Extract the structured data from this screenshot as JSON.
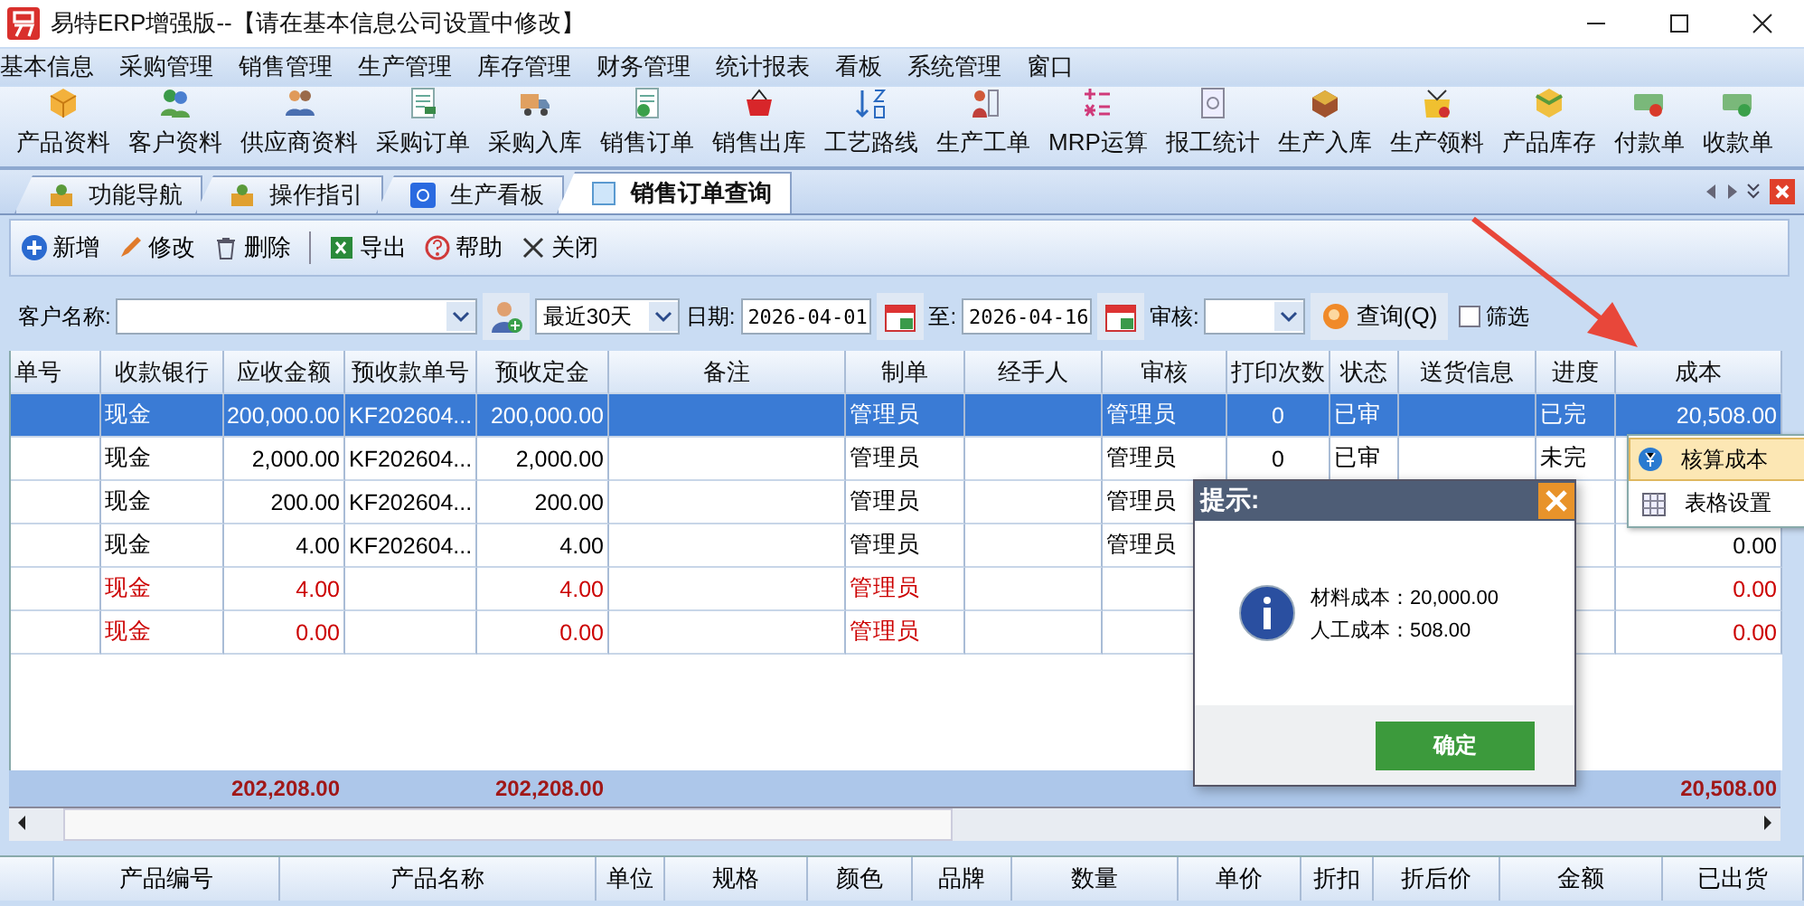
{
  "window": {
    "title": "易特ERP增强版--【请在基本信息公司设置中修改】"
  },
  "menu": [
    "基本信息",
    "采购管理",
    "销售管理",
    "生产管理",
    "库存管理",
    "财务管理",
    "统计报表",
    "看板",
    "系统管理",
    "窗口"
  ],
  "toolbar": [
    "产品资料",
    "客户资料",
    "供应商资料",
    "采购订单",
    "采购入库",
    "销售订单",
    "销售出库",
    "工艺路线",
    "生产工单",
    "MRP运算",
    "报工统计",
    "生产入库",
    "生产领料",
    "产品库存",
    "付款单",
    "收款单"
  ],
  "tabs": [
    {
      "label": "功能导航",
      "selected": false
    },
    {
      "label": "操作指引",
      "selected": false
    },
    {
      "label": "生产看板",
      "selected": false
    },
    {
      "label": "销售订单查询",
      "selected": true
    }
  ],
  "actions": [
    "新增",
    "修改",
    "删除",
    "导出",
    "帮助",
    "关闭"
  ],
  "filter": {
    "customer_label": "客户名称:",
    "period": "最近30天",
    "date_label": "日期:",
    "date_from": "2026-04-01",
    "to_label": "至:",
    "date_to": "2026-04-16",
    "audit_label": "审核:",
    "query_button": "查询(Q)",
    "filter_checkbox": {
      "label": "筛选",
      "checked": false
    }
  },
  "grid": {
    "columns": [
      "单号",
      "收款银行",
      "应收金额",
      "预收款单号",
      "预收定金",
      "备注",
      "制单",
      "经手人",
      "审核",
      "打印次数",
      "状态",
      "送货信息",
      "进度",
      "成本"
    ],
    "rows": [
      {
        "selected": true,
        "flagged": false,
        "bank": "现金",
        "receivable": "200,000.00",
        "prepay_no": "KF202604...",
        "deposit": "200,000.00",
        "creator": "管理员",
        "auditor": "管理员",
        "print_count": "0",
        "status": "已审",
        "progress": "已完",
        "cost": "20,508.00"
      },
      {
        "selected": false,
        "flagged": false,
        "bank": "现金",
        "receivable": "2,000.00",
        "prepay_no": "KF202604...",
        "deposit": "2,000.00",
        "creator": "管理员",
        "auditor": "管理员",
        "print_count": "0",
        "status": "已审",
        "progress": "未完"
      },
      {
        "selected": false,
        "flagged": false,
        "bank": "现金",
        "receivable": "200.00",
        "prepay_no": "KF202604...",
        "deposit": "200.00",
        "creator": "管理员",
        "auditor": "管理员"
      },
      {
        "selected": false,
        "flagged": false,
        "bank": "现金",
        "receivable": "4.00",
        "prepay_no": "KF202604...",
        "deposit": "4.00",
        "creator": "管理员",
        "auditor": "管理员",
        "cost": "0.00"
      },
      {
        "selected": false,
        "flagged": true,
        "bank": "现金",
        "receivable": "4.00",
        "deposit": "4.00",
        "creator": "管理员",
        "cost": "0.00"
      },
      {
        "selected": false,
        "flagged": true,
        "bank": "现金",
        "receivable": "0.00",
        "deposit": "0.00",
        "creator": "管理员",
        "cost": "0.00"
      }
    ],
    "totals": {
      "receivable": "202,208.00",
      "deposit": "202,208.00",
      "cost": "20,508.00"
    }
  },
  "detail_grid": {
    "columns": [
      "产品编号",
      "产品名称",
      "单位",
      "规格",
      "颜色",
      "品牌",
      "数量",
      "单价",
      "折扣",
      "折后价",
      "金额",
      "已出货"
    ]
  },
  "dialog": {
    "title": "提示:",
    "lines": [
      "材料成本：20,000.00",
      "人工成本：508.00"
    ],
    "ok_button": "确定"
  },
  "context_menu": [
    {
      "label": "核算成本",
      "selected": true
    },
    {
      "label": "表格设置",
      "selected": false
    }
  ]
}
